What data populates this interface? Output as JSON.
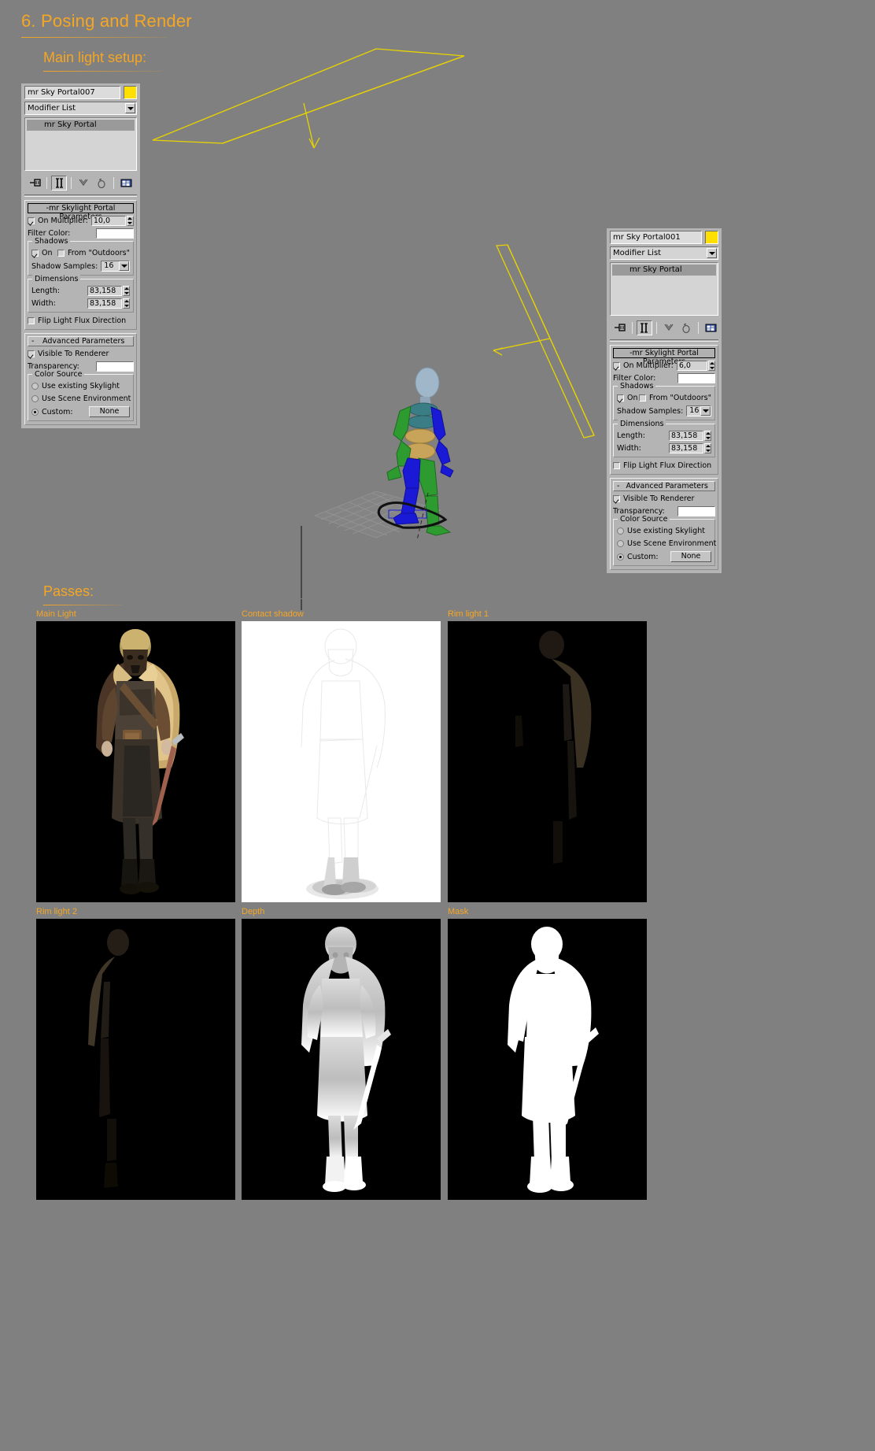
{
  "headings": {
    "section": "6. Posing and Render",
    "subsection": "Main light setup:",
    "passes": "Passes:"
  },
  "panels": [
    {
      "id": "left",
      "object_name": "mr Sky Portal007",
      "color_swatch": "#ffe000",
      "modifier_list_label": "Modifier List",
      "stack_items": [
        "mr Sky Portal"
      ],
      "toolbar_icons": [
        "pin-stack-icon",
        "show-end-result-icon",
        "make-unique-icon",
        "remove-modifier-icon",
        "configure-modifier-sets-icon"
      ],
      "rollouts": [
        {
          "title": "-mr Skylight Portal Parameters",
          "on_label": "On Multiplier:",
          "on_checked": true,
          "multiplier": "10,0",
          "filter_color_label": "Filter Color:",
          "filter_color": "#ffffff",
          "shadows_group": "Shadows",
          "shadow_on_label": "On",
          "shadow_on_checked": true,
          "from_outdoors_label": "From \"Outdoors\"",
          "from_outdoors_checked": false,
          "shadow_samples_label": "Shadow Samples:",
          "shadow_samples": "16",
          "dimensions_group": "Dimensions",
          "length_label": "Length:",
          "length": "83,158",
          "width_label": "Width:",
          "width": "83,158",
          "flip_label": "Flip Light Flux Direction",
          "flip_checked": false
        },
        {
          "title": "Advanced Parameters",
          "collapse_glyph": "-",
          "visible_label": "Visible To Renderer",
          "visible_checked": true,
          "transparency_label": "Transparency:",
          "transparency_color": "#ffffff",
          "color_source_group": "Color Source",
          "options": [
            {
              "label": "Use existing Skylight",
              "selected": false
            },
            {
              "label": "Use Scene Environment",
              "selected": false
            },
            {
              "label": "Custom:",
              "selected": true
            }
          ],
          "custom_button": "None"
        }
      ]
    },
    {
      "id": "right",
      "object_name": "mr Sky Portal001",
      "color_swatch": "#ffe000",
      "modifier_list_label": "Modifier List",
      "stack_items": [
        "mr Sky Portal"
      ],
      "toolbar_icons": [
        "pin-stack-icon",
        "show-end-result-icon",
        "make-unique-icon",
        "remove-modifier-icon",
        "configure-modifier-sets-icon"
      ],
      "rollouts": [
        {
          "title": "-mr Skylight Portal Parameters",
          "on_label": "On Multiplier:",
          "on_checked": true,
          "multiplier": "6,0",
          "filter_color_label": "Filter Color:",
          "filter_color": "#ffffff",
          "shadows_group": "Shadows",
          "shadow_on_label": "On",
          "shadow_on_checked": true,
          "from_outdoors_label": "From \"Outdoors\"",
          "from_outdoors_checked": false,
          "shadow_samples_label": "Shadow Samples:",
          "shadow_samples": "16",
          "dimensions_group": "Dimensions",
          "length_label": "Length:",
          "length": "83,158",
          "width_label": "Width:",
          "width": "83,158",
          "flip_label": "Flip Light Flux Direction",
          "flip_checked": false
        },
        {
          "title": "Advanced Parameters",
          "collapse_glyph": "-",
          "visible_label": "Visible To Renderer",
          "visible_checked": true,
          "transparency_label": "Transparency:",
          "transparency_color": "#ffffff",
          "color_source_group": "Color Source",
          "options": [
            {
              "label": "Use existing Skylight",
              "selected": false
            },
            {
              "label": "Use Scene Environment",
              "selected": false
            },
            {
              "label": "Custom:",
              "selected": true
            }
          ],
          "custom_button": "None"
        }
      ]
    }
  ],
  "viewport": {
    "gizmo_color": "#e8d300",
    "grid_color": "#8f8f8f",
    "biped_colors": {
      "green": "#2d9b30",
      "blue": "#1a1ad6",
      "teal": "#3a7d85",
      "tan": "#c8a45a",
      "head": "#9fb7c9"
    }
  },
  "passes": [
    {
      "label": "Main Light",
      "name": "pass-main-light",
      "bg": "#000000"
    },
    {
      "label": "Contact shadow",
      "name": "pass-contact-shadow",
      "bg": "#ffffff"
    },
    {
      "label": "Rim light 1",
      "name": "pass-rim-light-1",
      "bg": "#000000"
    },
    {
      "label": "Rim light 2",
      "name": "pass-rim-light-2",
      "bg": "#000000"
    },
    {
      "label": "Depth",
      "name": "pass-depth",
      "bg": "#000000"
    },
    {
      "label": "Mask",
      "name": "pass-mask",
      "bg": "#000000"
    }
  ],
  "colors": {
    "page_background": "#808080",
    "accent": "#f5a623",
    "panel_face": "#b4b4b4"
  }
}
